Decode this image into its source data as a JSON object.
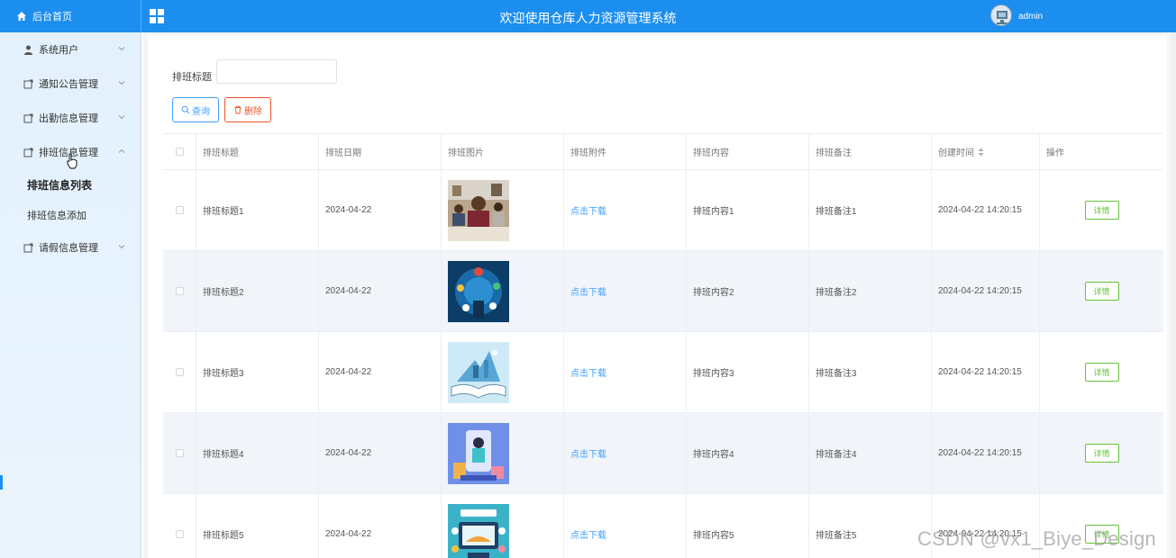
{
  "header": {
    "home_label": "后台首页",
    "title": "欢迎使用仓库人力资源管理系统",
    "username": "admin"
  },
  "sidebar": {
    "items": [
      {
        "label": "系统用户",
        "icon": "user-icon",
        "expanded": false
      },
      {
        "label": "通知公告管理",
        "icon": "doc-icon",
        "expanded": false
      },
      {
        "label": "出勤信息管理",
        "icon": "doc-icon",
        "expanded": false
      },
      {
        "label": "排班信息管理",
        "icon": "doc-icon",
        "expanded": true
      },
      {
        "label": "请假信息管理",
        "icon": "doc-icon",
        "expanded": false
      }
    ],
    "subitems": [
      {
        "label": "排班信息列表",
        "active": true
      },
      {
        "label": "排班信息添加",
        "active": false
      }
    ]
  },
  "search": {
    "label": "排班标题",
    "value": "",
    "placeholder": ""
  },
  "buttons": {
    "query": "查询",
    "delete": "删除"
  },
  "table": {
    "columns": [
      "排班标题",
      "排班日期",
      "排班图片",
      "排班附件",
      "排班内容",
      "排班备注",
      "创建时间",
      "操作"
    ],
    "rows": [
      {
        "title": "排班标题1",
        "date": "2024-04-22",
        "attachment": "点击下载",
        "content": "排班内容1",
        "note": "排班备注1",
        "created": "2024-04-22 14:20:15",
        "action": "详情"
      },
      {
        "title": "排班标题2",
        "date": "2024-04-22",
        "attachment": "点击下载",
        "content": "排班内容2",
        "note": "排班备注2",
        "created": "2024-04-22 14:20:15",
        "action": "详情"
      },
      {
        "title": "排班标题3",
        "date": "2024-04-22",
        "attachment": "点击下载",
        "content": "排班内容3",
        "note": "排班备注3",
        "created": "2024-04-22 14:20:15",
        "action": "详情"
      },
      {
        "title": "排班标题4",
        "date": "2024-04-22",
        "attachment": "点击下载",
        "content": "排班内容4",
        "note": "排班备注4",
        "created": "2024-04-22 14:20:15",
        "action": "详情"
      },
      {
        "title": "排班标题5",
        "date": "2024-04-22",
        "attachment": "点击下载",
        "content": "排班内容5",
        "note": "排班备注5",
        "created": "2024-04-22 14:20:15",
        "action": "详情"
      }
    ]
  },
  "watermark": "CSDN @vx1_Biye_Design",
  "colors": {
    "primary": "#1c8ef0",
    "link": "#409eff",
    "danger": "#e8572b",
    "success": "#67c23a",
    "sidebar_bg": "#e3f1fd"
  }
}
